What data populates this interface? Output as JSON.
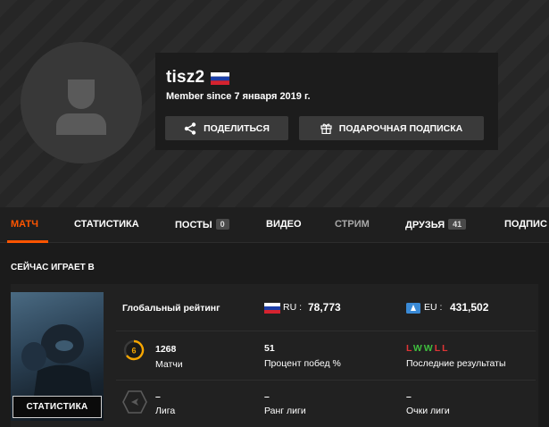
{
  "profile": {
    "username": "tisz2",
    "country": "Russia",
    "member_since": "Member since 7 января 2019 г.",
    "share_label": "ПОДЕЛИТЬСЯ",
    "gift_label": "ПОДАРОЧНАЯ ПОДПИСКА"
  },
  "nav": {
    "tabs": [
      {
        "label": "МАТЧ"
      },
      {
        "label": "СТАТИСТИКА"
      },
      {
        "label": "ПОСТЫ",
        "badge": "0"
      },
      {
        "label": "ВИДЕО"
      },
      {
        "label": "СТРИМ"
      },
      {
        "label": "ДРУЗЬЯ",
        "badge": "41"
      },
      {
        "label": "ПОДПИС"
      }
    ]
  },
  "playing": {
    "section_title": "СЕЙЧАС ИГРАЕТ В",
    "game_logo_text": "СТАТИСТИКА",
    "global_rating_label": "Глобальный рейтинг",
    "ru_label": "RU :",
    "ru_value": "78,773",
    "eu_label": "EU :",
    "eu_value": "431,502",
    "level": "6",
    "matches_value": "1268",
    "matches_label": "Матчи",
    "winrate_value": "51",
    "winrate_label": "Процент побед %",
    "recent_results": [
      "L",
      "W",
      "W",
      "L",
      "L"
    ],
    "recent_label": "Последние результаты",
    "league_value": "–",
    "league_label": "Лига",
    "league_rank_value": "–",
    "league_rank_label": "Ранг лиги",
    "league_points_value": "–",
    "league_points_label": "Очки лиги"
  },
  "colors": {
    "accent": "#ff5500",
    "win": "#3fbf3f",
    "loss": "#e03535",
    "level_ring": "#f7a600"
  }
}
